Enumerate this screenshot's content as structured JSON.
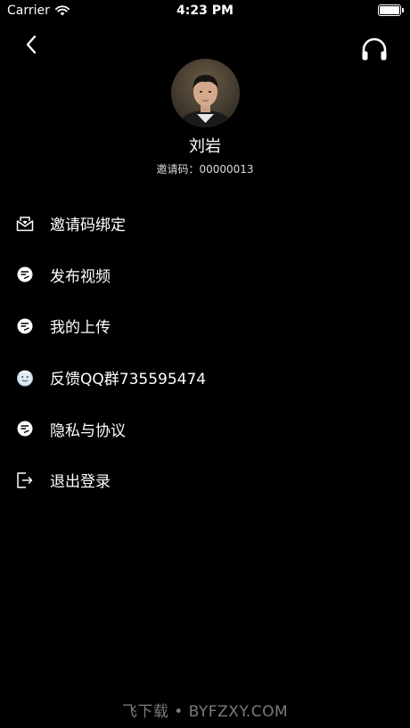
{
  "status_bar": {
    "carrier": "Carrier",
    "time": "4:23 PM"
  },
  "header": {
    "back_icon": "chevron-left-icon",
    "support_icon": "headset-icon"
  },
  "profile": {
    "name": "刘岩",
    "invite_label": "邀请码：",
    "invite_code": "00000013"
  },
  "menu": {
    "items": [
      {
        "label": "邀请码绑定",
        "icon": "envelope-heart-icon"
      },
      {
        "label": "发布视频",
        "icon": "chat-bubble-icon"
      },
      {
        "label": "我的上传",
        "icon": "chat-bubble-icon"
      },
      {
        "label": "反馈QQ群735595474",
        "icon": "snowman-icon"
      },
      {
        "label": "隐私与协议",
        "icon": "chat-bubble-icon"
      },
      {
        "label": "退出登录",
        "icon": "logout-icon"
      }
    ]
  },
  "watermark": {
    "text": "飞下载 • BYFZXY.COM"
  },
  "colors": {
    "background": "#000000",
    "text": "#ffffff",
    "muted": "#dcdcdc",
    "watermark": "#7a7a7a"
  }
}
